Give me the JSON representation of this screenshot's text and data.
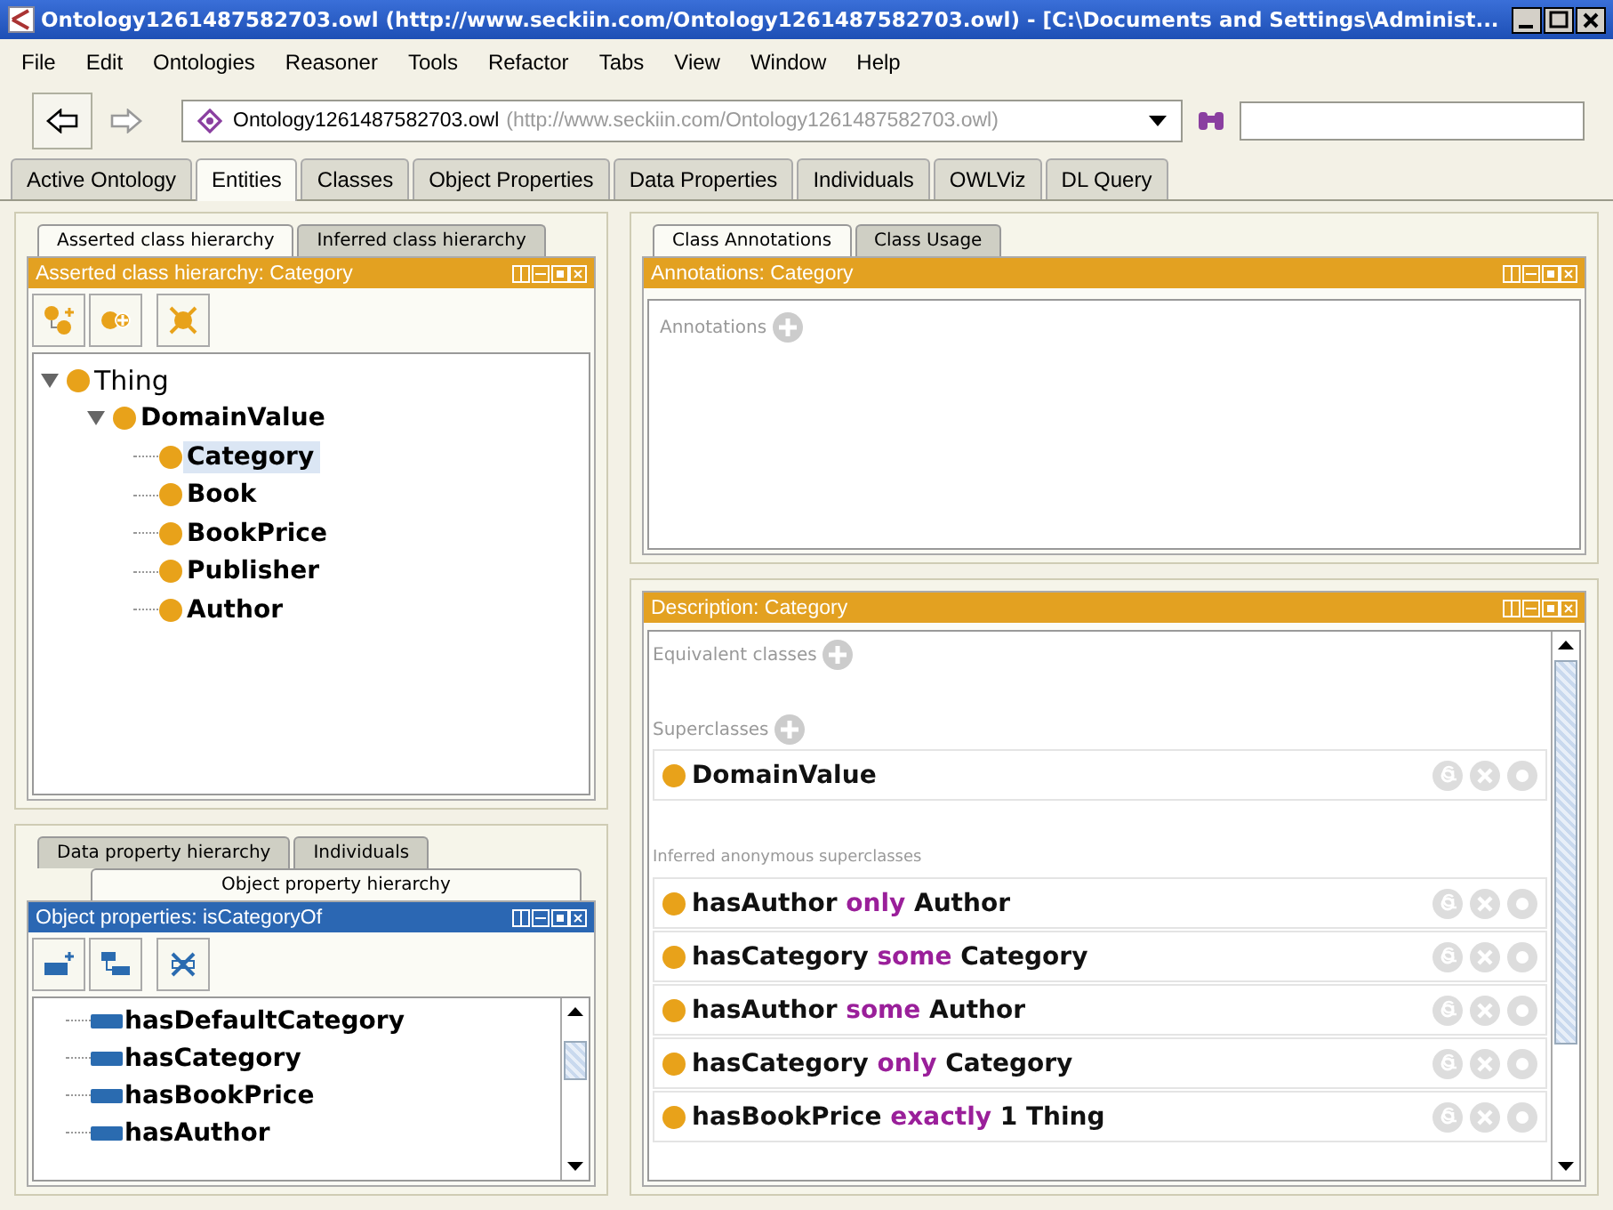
{
  "window": {
    "title": "Ontology1261487582703.owl (http://www.seckiin.com/Ontology1261487582703.owl) - [C:\\Documents and Settings\\Administ..."
  },
  "menu": [
    "File",
    "Edit",
    "Ontologies",
    "Reasoner",
    "Tools",
    "Refactor",
    "Tabs",
    "View",
    "Window",
    "Help"
  ],
  "toolbar": {
    "ontology": "Ontology1261487582703.owl",
    "ontology_iri": "(http://www.seckiin.com/Ontology1261487582703.owl)"
  },
  "tabs": [
    {
      "label": "Active Ontology",
      "selected": false
    },
    {
      "label": "Entities",
      "selected": true
    },
    {
      "label": "Classes",
      "selected": false
    },
    {
      "label": "Object Properties",
      "selected": false
    },
    {
      "label": "Data Properties",
      "selected": false
    },
    {
      "label": "Individuals",
      "selected": false
    },
    {
      "label": "OWLViz",
      "selected": false
    },
    {
      "label": "DL Query",
      "selected": false
    }
  ],
  "class_panel": {
    "tabs": [
      {
        "label": "Asserted class hierarchy",
        "selected": true
      },
      {
        "label": "Inferred class hierarchy",
        "selected": false
      }
    ],
    "header": {
      "text": "Asserted class hierarchy: Category",
      "kind": "class"
    },
    "tree": [
      {
        "label": "Thing",
        "expanded": true,
        "selected": false,
        "children": [
          {
            "label": "DomainValue",
            "expanded": true,
            "selected": false,
            "children": [
              {
                "label": "Category",
                "selected": true
              },
              {
                "label": "Book",
                "selected": false
              },
              {
                "label": "BookPrice",
                "selected": false
              },
              {
                "label": "Publisher",
                "selected": false
              },
              {
                "label": "Author",
                "selected": false
              }
            ]
          }
        ]
      }
    ]
  },
  "property_panel": {
    "tabs": [
      {
        "label": "Data property hierarchy",
        "selected": false
      },
      {
        "label": "Individuals",
        "selected": false
      },
      {
        "label": "Object property hierarchy",
        "selected": true
      }
    ],
    "header": {
      "text": "Object properties: isCategoryOf",
      "kind": "object_property"
    },
    "items": [
      "hasDefaultCategory",
      "hasCategory",
      "hasBookPrice",
      "hasAuthor"
    ]
  },
  "annotations_panel": {
    "tabs": [
      {
        "label": "Class Annotations",
        "selected": true
      },
      {
        "label": "Class Usage",
        "selected": false
      }
    ],
    "header": {
      "text": "Annotations: Category",
      "kind": "class"
    },
    "section": "Annotations"
  },
  "description_panel": {
    "header": {
      "text": "Description: Category",
      "kind": "class"
    },
    "sections": [
      {
        "title": "Equivalent classes",
        "kind": "editable"
      },
      {
        "title": "Superclasses",
        "kind": "editable",
        "rows": [
          {
            "parts": [
              {
                "text": "DomainValue",
                "kind": "entity"
              }
            ]
          }
        ]
      },
      {
        "title": "Inferred anonymous superclasses",
        "kind": "inferred",
        "rows": [
          {
            "parts": [
              {
                "text": "hasAuthor",
                "kind": "entity"
              },
              {
                "text": "only",
                "kind": "keyword"
              },
              {
                "text": "Author",
                "kind": "entity"
              }
            ]
          },
          {
            "parts": [
              {
                "text": "hasCategory",
                "kind": "entity"
              },
              {
                "text": "some",
                "kind": "keyword"
              },
              {
                "text": "Category",
                "kind": "entity"
              }
            ]
          },
          {
            "parts": [
              {
                "text": "hasAuthor",
                "kind": "entity"
              },
              {
                "text": "some",
                "kind": "keyword"
              },
              {
                "text": "Author",
                "kind": "entity"
              }
            ]
          },
          {
            "parts": [
              {
                "text": "hasCategory",
                "kind": "entity"
              },
              {
                "text": "only",
                "kind": "keyword"
              },
              {
                "text": "Category",
                "kind": "entity"
              }
            ]
          },
          {
            "parts": [
              {
                "text": "hasBookPrice",
                "kind": "entity"
              },
              {
                "text": "exactly",
                "kind": "keyword"
              },
              {
                "text": "1 Thing",
                "kind": "entity"
              }
            ]
          }
        ]
      }
    ]
  }
}
